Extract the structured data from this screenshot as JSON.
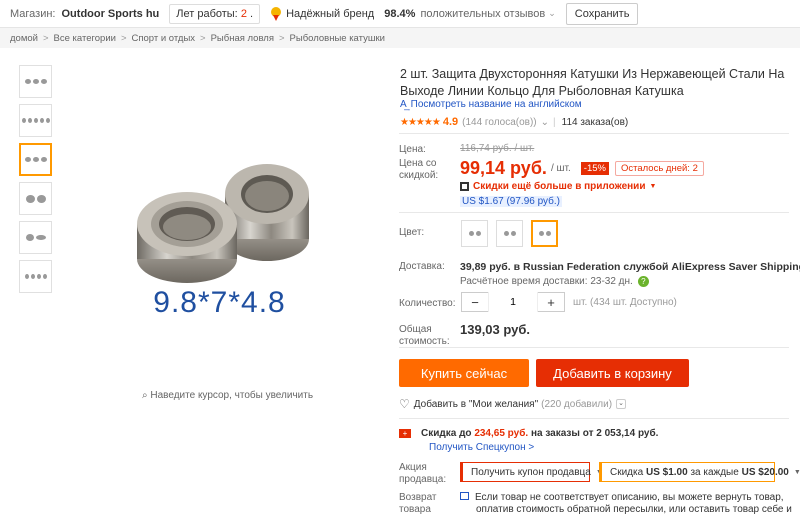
{
  "topbar": {
    "store_label": "Магазин:",
    "store_name": "Outdoor Sports hu",
    "years_label": "Лет работы:",
    "years_value": "2",
    "years_suffix": ".",
    "brand_label": "Надёжный бренд",
    "feedback_percent": "98.4%",
    "feedback_label": "положительных отзывов",
    "save_label": "Сохранить"
  },
  "breadcrumb": [
    "домой",
    "Все категории",
    "Спорт и отдых",
    "Рыбная ловля",
    "Рыболовные катушки"
  ],
  "gallery": {
    "size_label": "9.8*7*4.8",
    "zoom_hint": "Наведите курсор, чтобы увеличить"
  },
  "product": {
    "title": "2 шт. Защита Двухсторонняя Катушки Из Нержавеющей Стали На Выходе Линии Кольцо Для Рыболовная Катушка",
    "english_link": "Посмотреть название на английском",
    "rating": "4.9",
    "votes": "(144 голоса(ов))",
    "orders": "114 заказа(ов)"
  },
  "price": {
    "price_label": "Цена:",
    "old_price": "116,74 руб. / шт.",
    "discount_label_1": "Цена со",
    "discount_label_2": "скидкой:",
    "new_price": "99,14 руб.",
    "unit": "/ шт.",
    "discount": "-15%",
    "days_left": "Осталось дней: 2",
    "app_discount": "Скидки ещё больше в приложении",
    "usd": "US $1.67 (97.96 руб.)"
  },
  "color": {
    "label": "Цвет:",
    "selected_index": 2
  },
  "shipping": {
    "label": "Доставка:",
    "text": "39,89 руб. в Russian Federation службой AliExpress Saver Shipping",
    "eta": "Расчётное время доставки: 23-32 дн."
  },
  "quantity": {
    "label": "Количество:",
    "value": "1",
    "minus": "−",
    "plus": "+",
    "available": "шт. (434 шт. Доступно)"
  },
  "total": {
    "label_1": "Общая",
    "label_2": "стоимость:",
    "value": "139,03 руб."
  },
  "actions": {
    "buy_now": "Купить сейчас",
    "add_to_cart": "Добавить в корзину",
    "wishlist": "Добавить в \"Мои желания\"",
    "wishlist_count": "(220 добавили)"
  },
  "promo": {
    "discount_prefix": "Скидка до",
    "discount_value": "234,65 руб.",
    "discount_suffix": "на заказы от 2 053,14 руб.",
    "coupon_link": "Получить Спецкупон >",
    "seller_label_1": "Акция",
    "seller_label_2": "продавца:",
    "coupon_seller": "Получить купон продавца",
    "coupon_discount_prefix": "Скидка",
    "coupon_discount_value": "US $1.00",
    "coupon_discount_mid": "за каждые",
    "coupon_discount_threshold": "US $20.00",
    "return_label_1": "Возврат",
    "return_label_2": "товара",
    "return_text_1": "Если товар не соответствует описанию, вы можете вернуть товар,",
    "return_text_2": "оплатив стоимость обратной пересылки, или оставить товар себе и"
  },
  "colors": {
    "accent": "#ff6a00",
    "primary_red": "#e62e04",
    "link_blue": "#2256c4",
    "size_label": "#1f4fa0"
  }
}
